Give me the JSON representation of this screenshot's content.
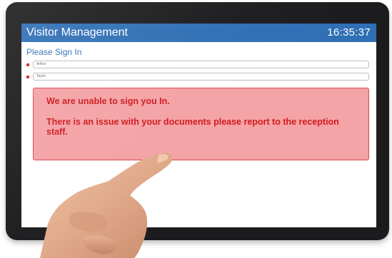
{
  "header": {
    "title": "Visitor Management",
    "clock": "16:35:37"
  },
  "form": {
    "heading": "Please Sign In",
    "first_name_value": "Arthur",
    "last_name_value": "Taylor"
  },
  "alert": {
    "line1": "We are unable to sign you In.",
    "line2": "There is an issue with your documents please report to the reception staff."
  },
  "colors": {
    "header_bg": "#2f6fb5",
    "alert_bg": "#f4a3a6",
    "alert_text": "#d11a1f"
  }
}
